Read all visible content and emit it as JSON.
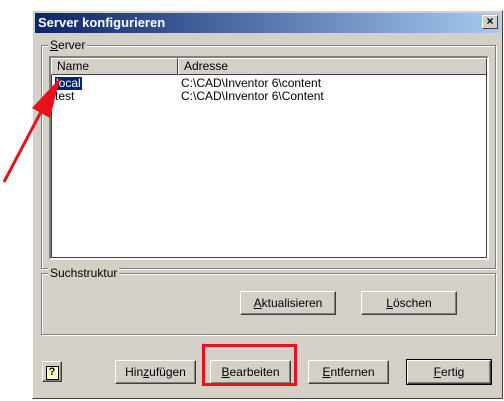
{
  "window": {
    "title": "Server konfigurieren",
    "close_label": "×"
  },
  "server_group": {
    "label_first": "S",
    "label_rest": "erver"
  },
  "list": {
    "columns": [
      "Name",
      "Adresse"
    ],
    "rows": [
      {
        "name": "local",
        "address": "C:\\CAD\\Inventor 6\\content"
      },
      {
        "name": "test",
        "address": "C:\\CAD\\Inventor 6\\Content"
      }
    ]
  },
  "search_group": {
    "label": "Suchstruktur"
  },
  "buttons": {
    "refresh_first": "A",
    "refresh_rest": "ktualisieren",
    "delete_first": "L",
    "delete_rest": "öschen",
    "help_glyph": "?",
    "add_pre": "Hin",
    "add_u": "z",
    "add_post": "ufügen",
    "edit_first": "B",
    "edit_rest": "earbeiten",
    "remove_first": "E",
    "remove_rest": "ntfernen",
    "done_first": "F",
    "done_rest": "ertig"
  },
  "colors": {
    "annotation_red": "#e8101a",
    "titlebar": "#0a246a",
    "selection": "#0a246a"
  }
}
